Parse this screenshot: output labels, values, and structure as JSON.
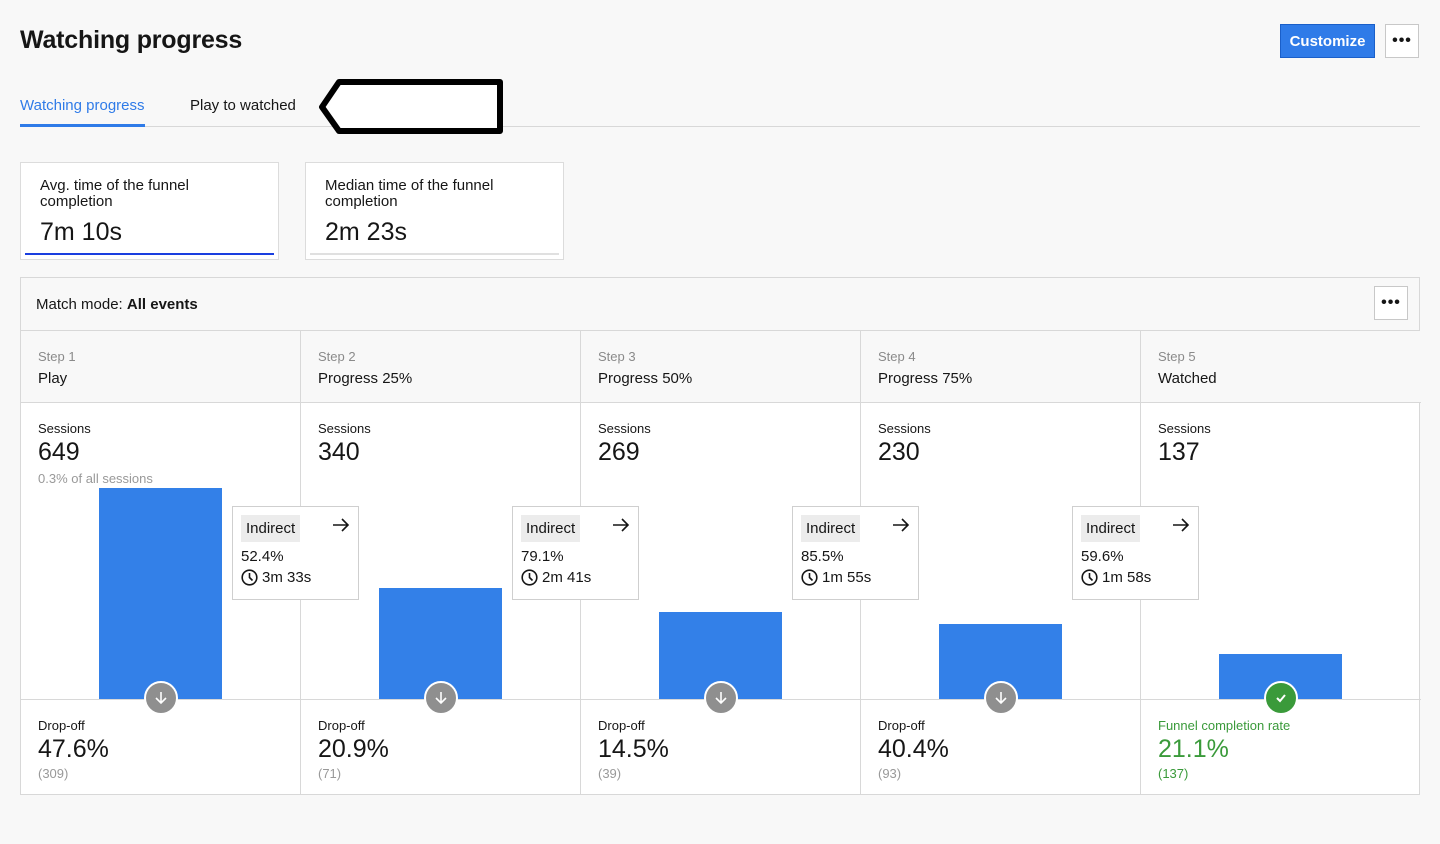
{
  "header": {
    "title": "Watching progress",
    "customize_label": "Customize",
    "more_icon": "ellipsis-icon"
  },
  "tabs": [
    {
      "label": "Watching progress",
      "active": true
    },
    {
      "label": "Play to watched",
      "active": false
    }
  ],
  "cards": [
    {
      "label": "Avg. time of the funnel completion",
      "value": "7m 10s",
      "selected": true
    },
    {
      "label": "Median time of the funnel completion",
      "value": "2m 23s",
      "selected": false
    }
  ],
  "panel": {
    "match_label": "Match mode:",
    "match_value": "All events",
    "sessions_label": "Sessions",
    "dropoff_label": "Drop-off",
    "completion_label": "Funnel completion rate",
    "indirect_label": "Indirect"
  },
  "colors": {
    "accent": "#2f7be8",
    "bar": "#3380e8",
    "success": "#3a9a3a",
    "dropoff_icon": "#8f8f8f"
  },
  "steps": [
    {
      "step": "Step 1",
      "name": "Play",
      "sessions": 649,
      "sessions_text": "649",
      "share": "0.3% of all sessions",
      "drop": "47.6%",
      "drop_count": "(309)"
    },
    {
      "step": "Step 2",
      "name": "Progress 25%",
      "sessions": 340,
      "sessions_text": "340",
      "drop": "20.9%",
      "drop_count": "(71)",
      "indirect_pct": "52.4%",
      "indirect_time": "3m 33s"
    },
    {
      "step": "Step 3",
      "name": "Progress 50%",
      "sessions": 269,
      "sessions_text": "269",
      "drop": "14.5%",
      "drop_count": "(39)",
      "indirect_pct": "79.1%",
      "indirect_time": "2m 41s"
    },
    {
      "step": "Step 4",
      "name": "Progress 75%",
      "sessions": 230,
      "sessions_text": "230",
      "drop": "40.4%",
      "drop_count": "(93)",
      "indirect_pct": "85.5%",
      "indirect_time": "1m 55s"
    },
    {
      "step": "Step 5",
      "name": "Watched",
      "sessions": 137,
      "sessions_text": "137",
      "drop": "21.1%",
      "drop_count": "(137)",
      "indirect_pct": "59.6%",
      "indirect_time": "1m 58s",
      "completion": true
    }
  ]
}
